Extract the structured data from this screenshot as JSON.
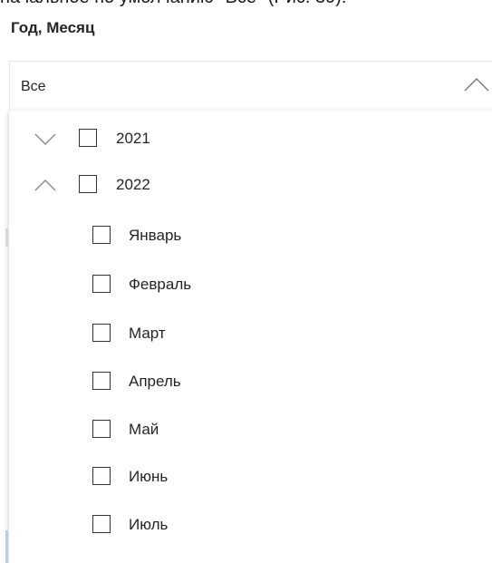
{
  "context_text": "начальное по умолчанию \"Все\" (Рис. 39):",
  "slicer": {
    "title": "Год, Месяц",
    "selected_value": "Все",
    "chevron_icon": "chevron-up-icon"
  },
  "years": [
    {
      "label": "2021",
      "expander_icon": "chevron-down-icon",
      "expanded": false
    },
    {
      "label": "2022",
      "expander_icon": "chevron-up-icon",
      "expanded": true
    }
  ],
  "months": [
    {
      "label": "Январь"
    },
    {
      "label": "Февраль"
    },
    {
      "label": "Март"
    },
    {
      "label": "Апрель"
    },
    {
      "label": "Май"
    },
    {
      "label": "Июнь"
    },
    {
      "label": "Июль"
    }
  ],
  "colors": {
    "text": "#252423",
    "border": "#e6e6e6",
    "checkbox_border": "#333333",
    "chevron": "#888888"
  }
}
